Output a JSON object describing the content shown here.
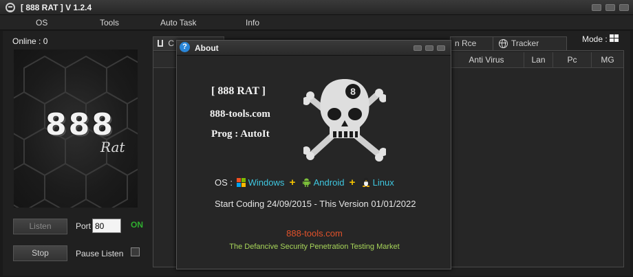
{
  "window": {
    "title": "[ 888 RAT  ] V 1.2.4"
  },
  "menu": [
    "OS",
    "Tools",
    "Auto Task",
    "Info"
  ],
  "left_panel": {
    "online": "Online : 0",
    "logo_number": "888",
    "logo_word": "Rat",
    "listen_label": "Listen",
    "port_label": "Port",
    "port_value": "80",
    "status": "ON",
    "stop_label": "Stop",
    "pause_label": "Pause Listen",
    "pause_checked": false
  },
  "tabs": {
    "first": "C",
    "rce": "n Rce",
    "tracker": "Tracker"
  },
  "columns": [
    "Anti Virus",
    "Lan",
    "Pc",
    "MG"
  ],
  "mode_label": "Mode :",
  "about": {
    "title": "About",
    "name": "[ 888 RAT ]",
    "site": "888-tools.com",
    "prog": "Prog : AutoIt",
    "os_label": "OS :",
    "os_windows": "Windows",
    "os_android": "Android",
    "os_linux": "Linux",
    "plus": "+",
    "coding": "Start Coding 24/09/2015   -   This Version 01/01/2022",
    "site_link": "888-tools.com",
    "tagline": "The Defancive Security Penetration Testing Market"
  },
  "colors": {
    "background": "#202020",
    "status_on": "#2fae2f",
    "os_text": "#3fc7e0",
    "plus": "#f5c400",
    "site_link": "#e2522b",
    "tagline": "#a8d65a"
  }
}
